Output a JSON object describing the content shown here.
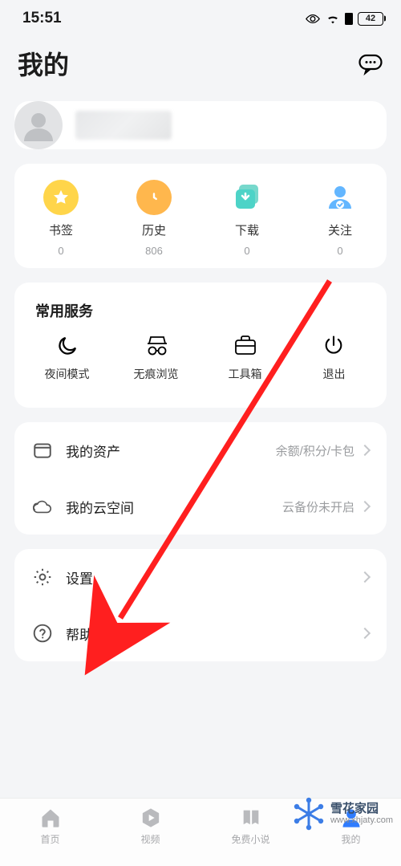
{
  "statusbar": {
    "time": "15:51",
    "battery": "42"
  },
  "header": {
    "title": "我的"
  },
  "quick": {
    "bookmark": {
      "label": "书签",
      "count": "0"
    },
    "history": {
      "label": "历史",
      "count": "806"
    },
    "download": {
      "label": "下载",
      "count": "0"
    },
    "follow": {
      "label": "关注",
      "count": "0"
    }
  },
  "services": {
    "title": "常用服务",
    "night": {
      "label": "夜间模式"
    },
    "incog": {
      "label": "无痕浏览"
    },
    "tools": {
      "label": "工具箱"
    },
    "exit": {
      "label": "退出"
    }
  },
  "rows": {
    "assets": {
      "label": "我的资产",
      "tail": "余额/积分/卡包"
    },
    "cloud": {
      "label": "我的云空间",
      "tail": "云备份未开启"
    },
    "settings": {
      "label": "设置"
    },
    "help": {
      "label": "帮助与客服"
    }
  },
  "tabs": {
    "home": {
      "label": "首页"
    },
    "video": {
      "label": "视频"
    },
    "novel": {
      "label": "免费小说"
    },
    "mine": {
      "label": "我的"
    }
  },
  "watermark": {
    "line1": "雪花家园",
    "line2": "www.xhjaty.com"
  }
}
